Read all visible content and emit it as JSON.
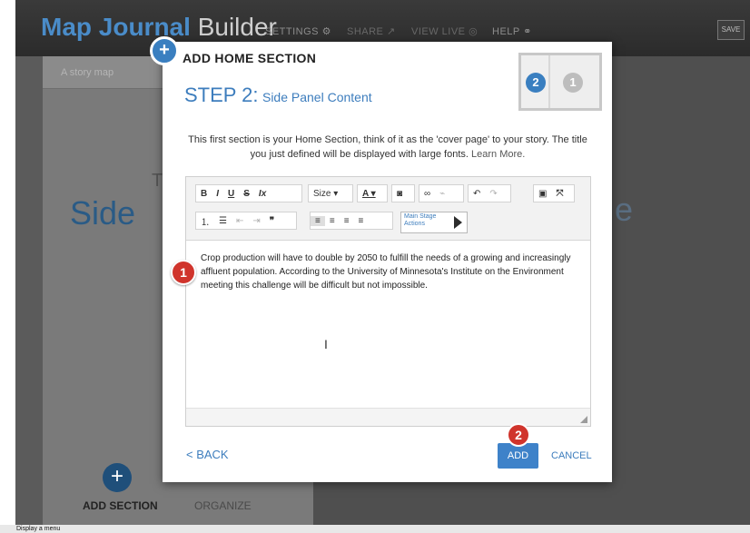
{
  "header": {
    "app_name": "Map Journal",
    "app_suffix": "Builder",
    "settings": "SETTINGS",
    "share": "SHARE",
    "view_live": "VIEW LIVE",
    "help": "HELP",
    "save": "SAVE"
  },
  "left_panel": {
    "story_label": "A story map",
    "preview_line1": "This",
    "preview_line2": "Side",
    "add_section": "ADD SECTION",
    "organize": "ORGANIZE",
    "add_icon": "plus-icon"
  },
  "right_preview": "e",
  "modal": {
    "title": "ADD HOME SECTION",
    "step_big": "STEP 2:",
    "step_small": "Side Panel Content",
    "intro": "This first section is your Home Section, think of it as the 'cover page' to your story. The title you just defined will be displayed with large fonts.",
    "learn_more": "Learn More.",
    "step_active": "2",
    "step_inactive": "1",
    "editor": {
      "toolbar_row1": [
        "B",
        "I",
        "U",
        "S",
        "Ix",
        "Size ▾",
        "A ▾",
        "camera-icon",
        "link-icon",
        "unlink-icon",
        "undo-icon",
        "redo-icon",
        "source-icon",
        "fullscreen-icon"
      ],
      "toolbar_row2": [
        "numbered-list-icon",
        "bullet-list-icon",
        "outdent-icon",
        "indent-icon",
        "quote-icon",
        "align-left-icon",
        "align-center-icon",
        "align-right-icon",
        "justify-icon"
      ],
      "main_stage_label": "Main Stage Actions",
      "body_text": "Crop production will have to double by 2050 to fulfill the needs of a growing and increasingly affluent population. According to the University of Minnesota's Institute on the Environment meeting this challenge will be difficult but not impossible."
    },
    "back": "< BACK",
    "add": "ADD",
    "cancel": "CANCEL",
    "badge_1": "1",
    "badge_2": "2"
  },
  "statusbar": "Display a menu",
  "colors": {
    "accent": "#3d7dbd",
    "badge_red": "#d0342c"
  }
}
